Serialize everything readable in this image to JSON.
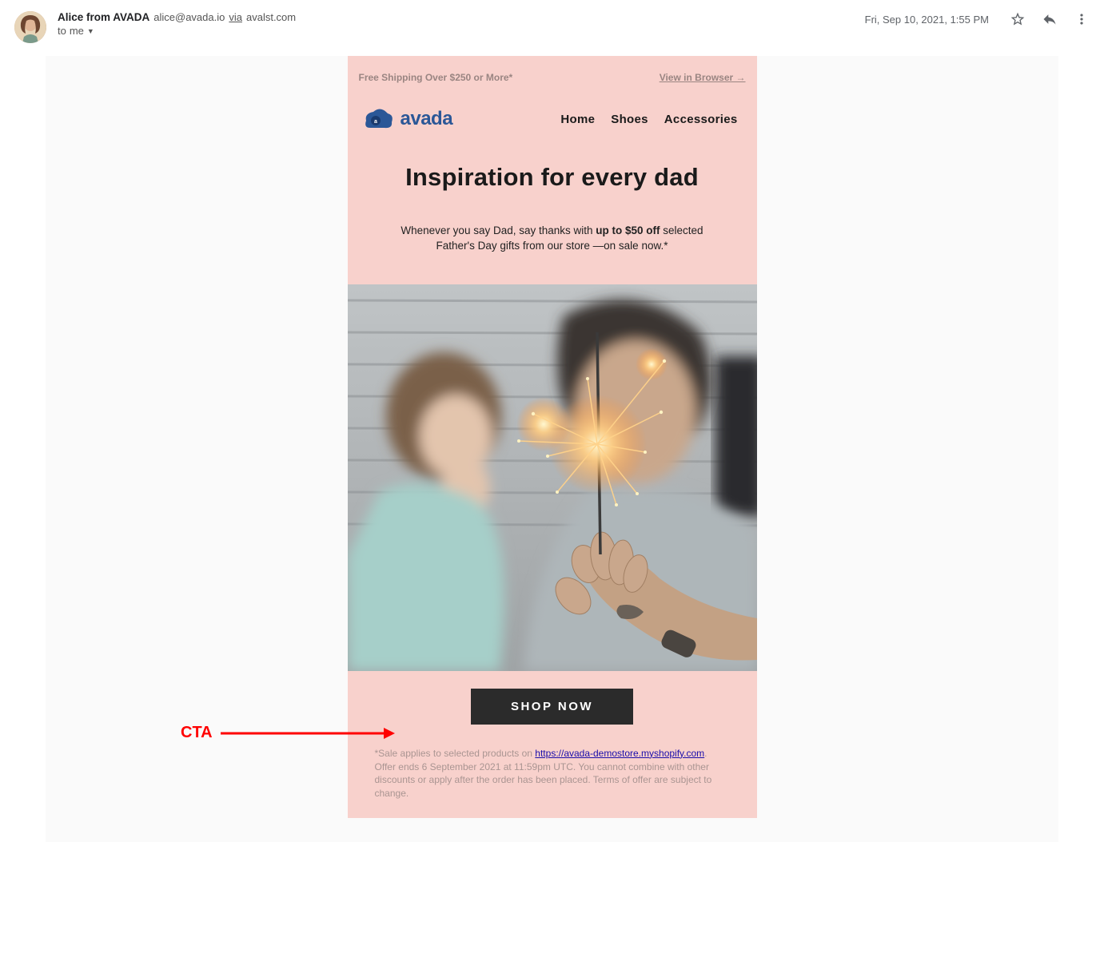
{
  "header": {
    "sender_name": "Alice from AVADA",
    "sender_email": "alice@avada.io",
    "via_label": "via",
    "via_host": "avalst.com",
    "to_label": "to",
    "recipient": "me",
    "timestamp": "Fri, Sep 10, 2021, 1:55 PM"
  },
  "promo": {
    "free_shipping": "Free Shipping Over $250 or More*",
    "view_browser": "View in Browser →"
  },
  "brand": {
    "name": "avada"
  },
  "nav": {
    "home": "Home",
    "shoes": "Shoes",
    "accessories": "Accessories"
  },
  "hero": {
    "title": "Inspiration for every dad",
    "subtitle_pre": "Whenever you say Dad, say thanks with ",
    "subtitle_bold": "up to $50 off",
    "subtitle_post": " selected Father's Day gifts from our store —on sale now.*"
  },
  "cta": {
    "label": "SHOP NOW"
  },
  "disclaimer": {
    "pre": "*Sale applies to selected products on ",
    "link": "https://avada-demostore.myshopify.com",
    "post": ". Offer ends 6 September 2021 at 11:59pm UTC. You cannot combine with other discounts or apply after the order has been placed. Terms of offer are subject to change."
  },
  "annotation": {
    "label": "CTA"
  }
}
